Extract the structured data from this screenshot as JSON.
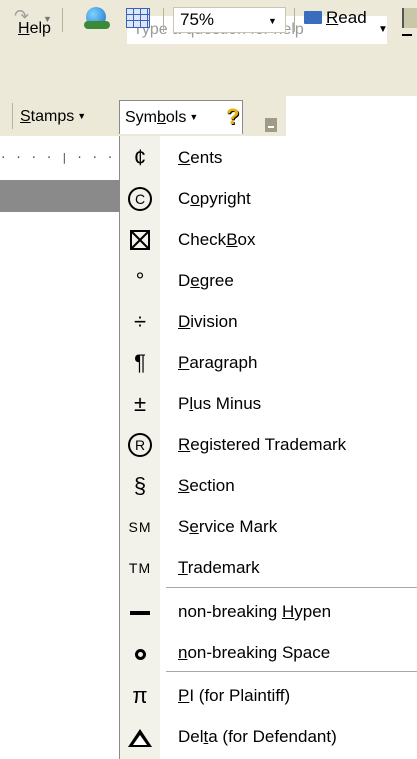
{
  "menubar": {
    "help_accel": "H",
    "help_rest": "elp",
    "ask_placeholder": "Type a question for help"
  },
  "toolbar": {
    "zoom_value": "75%",
    "read_accel": "R",
    "read_rest": "ead"
  },
  "toolbar2": {
    "stamps_accel": "S",
    "stamps_rest": "tamps",
    "symbols_pre": "Sym",
    "symbols_accel": "b",
    "symbols_post": "ols"
  },
  "ruler": {
    "text": "· · · · | · · ·"
  },
  "symbols_menu": [
    {
      "icon": "¢",
      "pre": "",
      "accel": "C",
      "post": "ents"
    },
    {
      "icon": "C",
      "pre": "C",
      "accel": "o",
      "post": "pyright"
    },
    {
      "icon": "",
      "pre": "Check",
      "accel": "B",
      "post": "ox"
    },
    {
      "icon": "°",
      "pre": "D",
      "accel": "e",
      "post": "gree"
    },
    {
      "icon": "÷",
      "pre": "",
      "accel": "D",
      "post": "ivision"
    },
    {
      "icon": "¶",
      "pre": "",
      "accel": "P",
      "post": "aragraph"
    },
    {
      "icon": "±",
      "pre": "P",
      "accel": "l",
      "post": "us Minus"
    },
    {
      "icon": "R",
      "pre": "",
      "accel": "R",
      "post": "egistered Trademark"
    },
    {
      "icon": "§",
      "pre": "",
      "accel": "S",
      "post": "ection"
    },
    {
      "icon": "SM",
      "pre": "S",
      "accel": "e",
      "post": "rvice Mark"
    },
    {
      "icon": "TM",
      "pre": "",
      "accel": "T",
      "post": "rademark"
    },
    {
      "icon": "",
      "pre": "non-breaking ",
      "accel": "H",
      "post": "ypen"
    },
    {
      "icon": "",
      "pre": "",
      "accel": "n",
      "post": "on-breaking Space"
    },
    {
      "icon": "π",
      "pre": "",
      "accel": "P",
      "post": "I (for Plaintiff)"
    },
    {
      "icon": "",
      "pre": "Del",
      "accel": "t",
      "post": "a (for Defendant)"
    }
  ]
}
